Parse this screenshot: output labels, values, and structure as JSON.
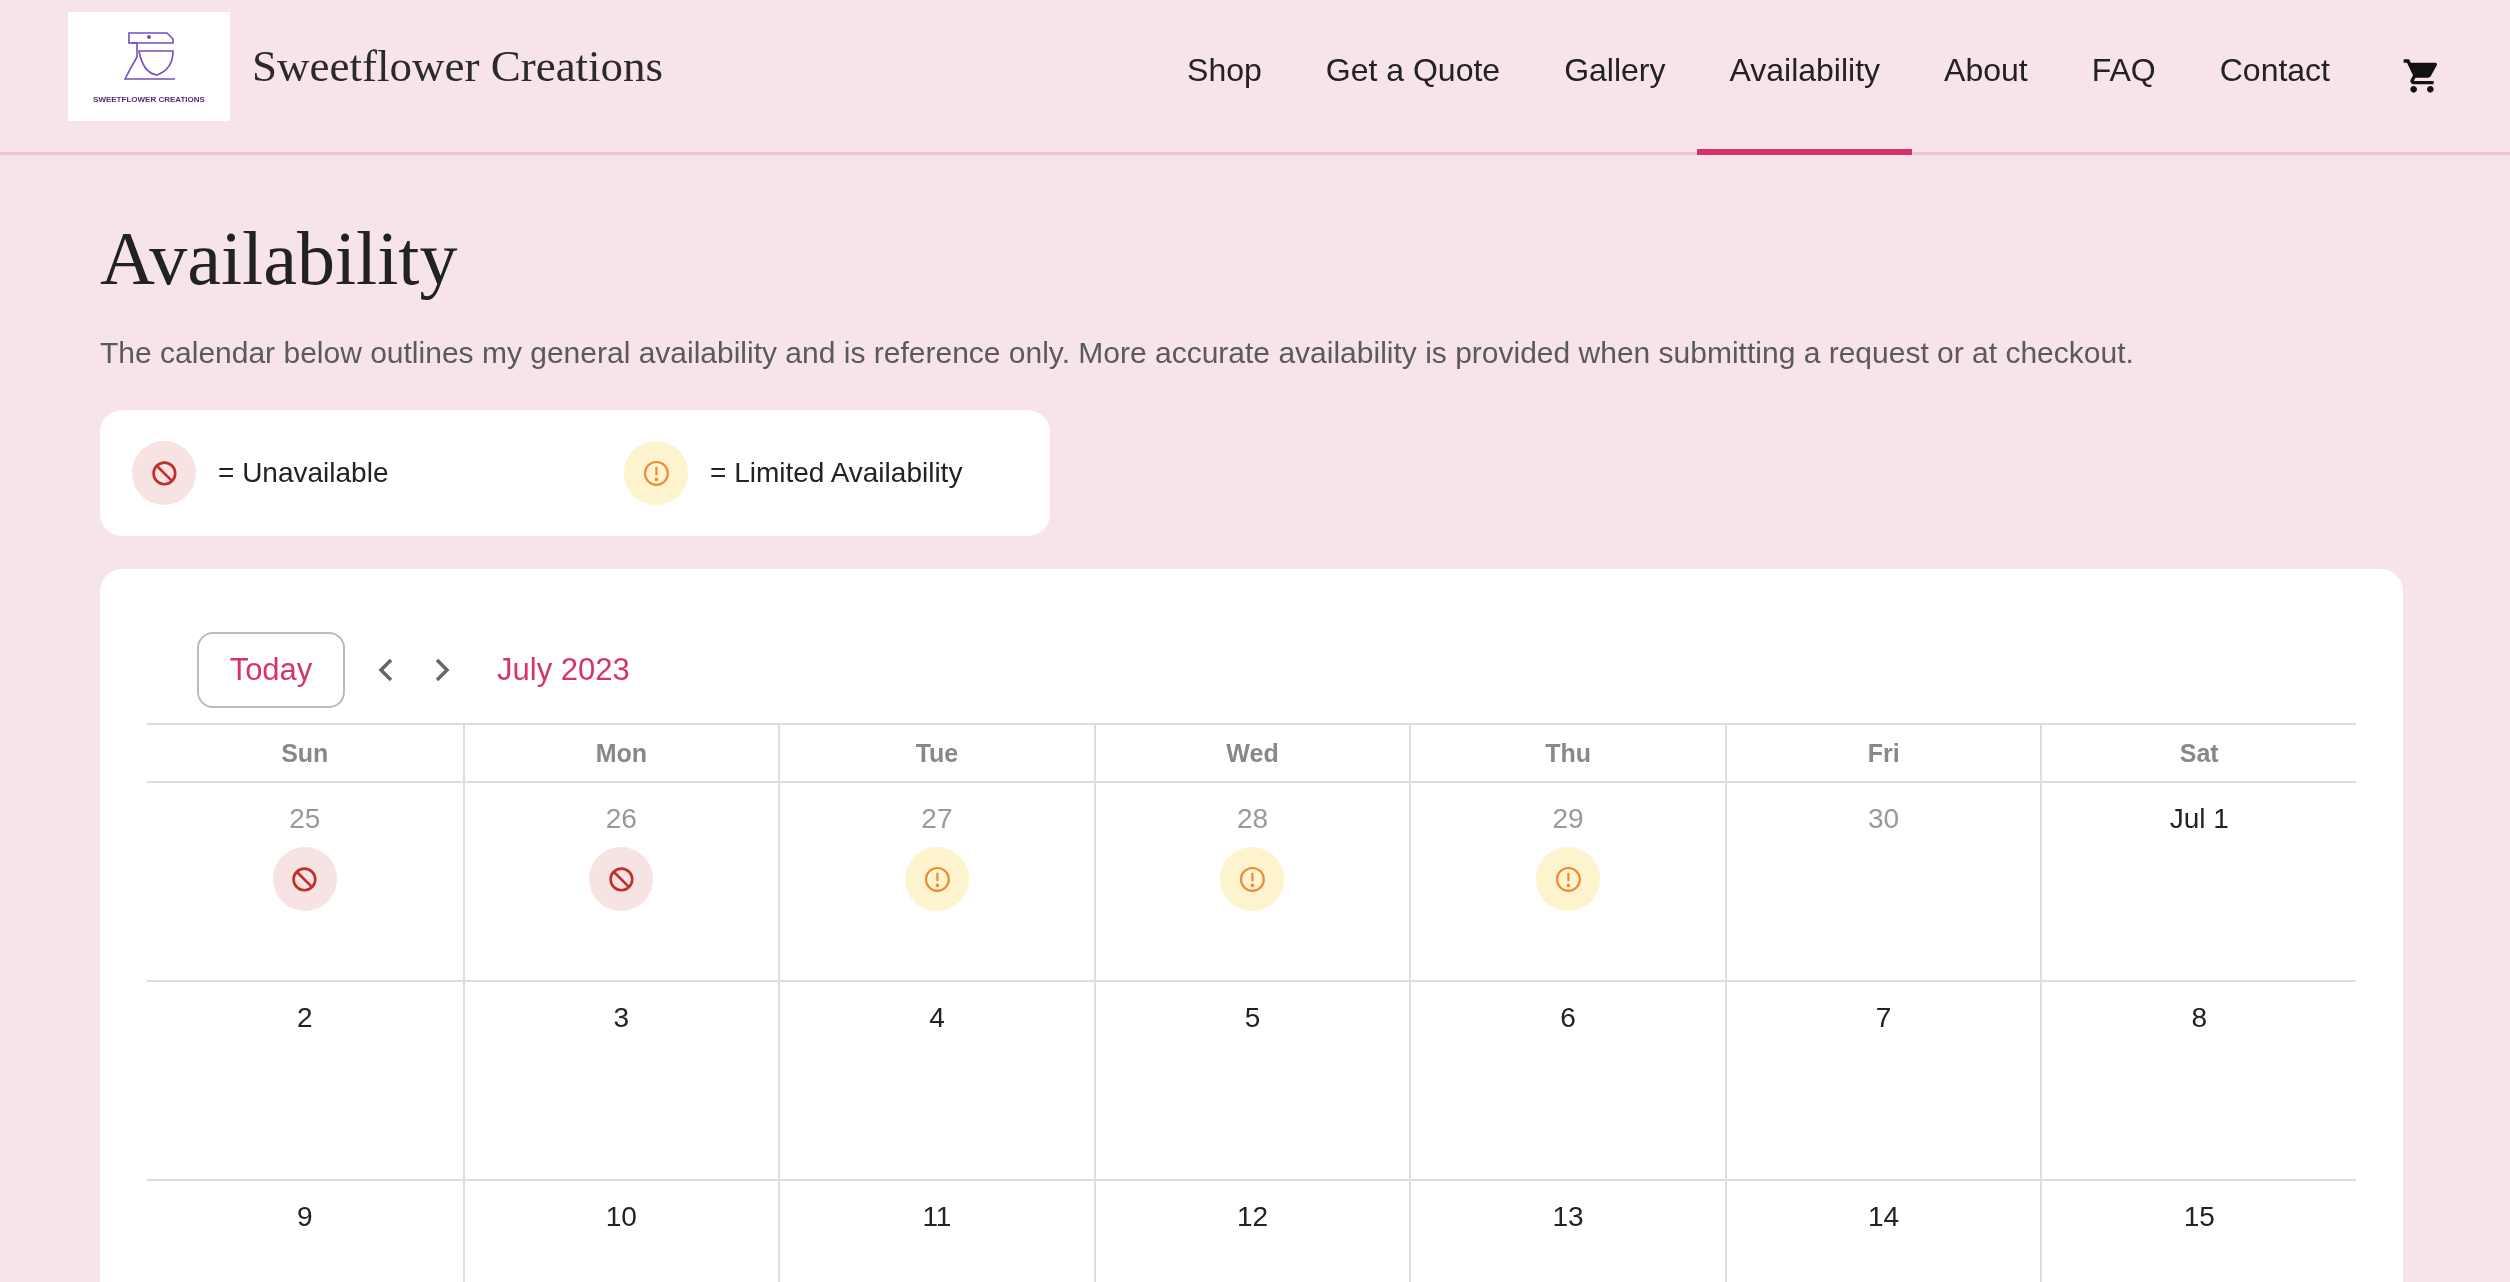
{
  "header": {
    "logo_text": "SWEETFLOWER CREATIONS",
    "site_title": "Sweetflower Creations",
    "nav": [
      {
        "label": "Shop",
        "selected": false
      },
      {
        "label": "Get a Quote",
        "selected": false
      },
      {
        "label": "Gallery",
        "selected": false
      },
      {
        "label": "Availability",
        "selected": true
      },
      {
        "label": "About",
        "selected": false
      },
      {
        "label": "FAQ",
        "selected": false
      },
      {
        "label": "Contact",
        "selected": false
      }
    ]
  },
  "page": {
    "title": "Availability",
    "intro": "The calendar below outlines my general availability and is reference only. More accurate availability is provided when submitting a request or at checkout."
  },
  "legend": [
    {
      "kind": "unavailable",
      "label": "= Unavailable"
    },
    {
      "kind": "limited",
      "label": "= Limited Availability"
    }
  ],
  "calendar": {
    "today_button": "Today",
    "month": "July 2023",
    "weekdays": [
      "Sun",
      "Mon",
      "Tue",
      "Wed",
      "Thu",
      "Fri",
      "Sat"
    ],
    "weeks": [
      [
        {
          "label": "25",
          "outside": true,
          "kind": "unavailable"
        },
        {
          "label": "26",
          "outside": true,
          "kind": "unavailable"
        },
        {
          "label": "27",
          "outside": true,
          "kind": "limited"
        },
        {
          "label": "28",
          "outside": true,
          "kind": "limited"
        },
        {
          "label": "29",
          "outside": true,
          "kind": "limited"
        },
        {
          "label": "30",
          "outside": true,
          "kind": "plain"
        },
        {
          "label": "Jul 1",
          "outside": false,
          "kind": "plain"
        }
      ],
      [
        {
          "label": "2",
          "outside": false,
          "kind": "plain"
        },
        {
          "label": "3",
          "outside": false,
          "kind": "plain"
        },
        {
          "label": "4",
          "outside": false,
          "kind": "plain"
        },
        {
          "label": "5",
          "outside": false,
          "kind": "plain"
        },
        {
          "label": "6",
          "outside": false,
          "kind": "plain"
        },
        {
          "label": "7",
          "outside": false,
          "kind": "plain"
        },
        {
          "label": "8",
          "outside": false,
          "kind": "plain"
        }
      ],
      [
        {
          "label": "9",
          "outside": false,
          "kind": "plain"
        },
        {
          "label": "10",
          "outside": false,
          "kind": "plain"
        },
        {
          "label": "11",
          "outside": false,
          "kind": "plain"
        },
        {
          "label": "12",
          "outside": false,
          "kind": "plain"
        },
        {
          "label": "13",
          "outside": false,
          "kind": "plain"
        },
        {
          "label": "14",
          "outside": false,
          "kind": "plain"
        },
        {
          "label": "15",
          "outside": false,
          "kind": "plain"
        }
      ]
    ]
  }
}
